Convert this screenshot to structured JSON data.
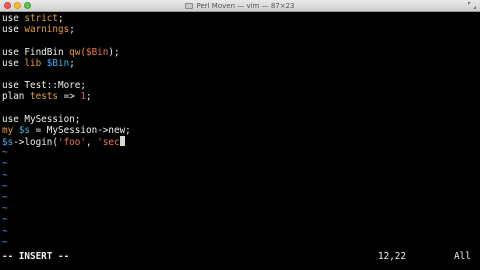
{
  "window": {
    "title": "Perl Moven — vim — 87×23"
  },
  "code": [
    [
      {
        "t": "use",
        "c": "plain"
      },
      {
        "t": " ",
        "c": "plain"
      },
      {
        "t": "strict",
        "c": "kw"
      },
      {
        "t": ";",
        "c": "plain"
      }
    ],
    [
      {
        "t": "use",
        "c": "plain"
      },
      {
        "t": " ",
        "c": "plain"
      },
      {
        "t": "warnings",
        "c": "kw"
      },
      {
        "t": ";",
        "c": "plain"
      }
    ],
    [],
    [
      {
        "t": "use FindBin ",
        "c": "plain"
      },
      {
        "t": "qw(",
        "c": "kw"
      },
      {
        "t": "$Bin",
        "c": "str"
      },
      {
        "t": ");",
        "c": "plain"
      }
    ],
    [
      {
        "t": "use ",
        "c": "plain"
      },
      {
        "t": "lib",
        "c": "kw"
      },
      {
        "t": " ",
        "c": "plain"
      },
      {
        "t": "$Bin",
        "c": "var"
      },
      {
        "t": ";",
        "c": "plain"
      }
    ],
    [],
    [
      {
        "t": "use Test::More;",
        "c": "plain"
      }
    ],
    [
      {
        "t": "plan ",
        "c": "plain"
      },
      {
        "t": "tests",
        "c": "kw"
      },
      {
        "t": " => ",
        "c": "plain"
      },
      {
        "t": "1",
        "c": "num"
      },
      {
        "t": ";",
        "c": "plain"
      }
    ],
    [],
    [
      {
        "t": "use MySession;",
        "c": "plain"
      }
    ],
    [
      {
        "t": "my",
        "c": "kw"
      },
      {
        "t": " ",
        "c": "plain"
      },
      {
        "t": "$s",
        "c": "var"
      },
      {
        "t": " = MySession->new;",
        "c": "plain"
      }
    ],
    [
      {
        "t": "$s",
        "c": "var"
      },
      {
        "t": "->login(",
        "c": "plain"
      },
      {
        "t": "'foo'",
        "c": "str"
      },
      {
        "t": ", ",
        "c": "plain"
      },
      {
        "t": "'sec",
        "c": "str"
      }
    ]
  ],
  "empty_marker": "~",
  "empty_line_count": 9,
  "status": {
    "mode": "-- INSERT --",
    "position": "12,22",
    "scroll": "All"
  }
}
